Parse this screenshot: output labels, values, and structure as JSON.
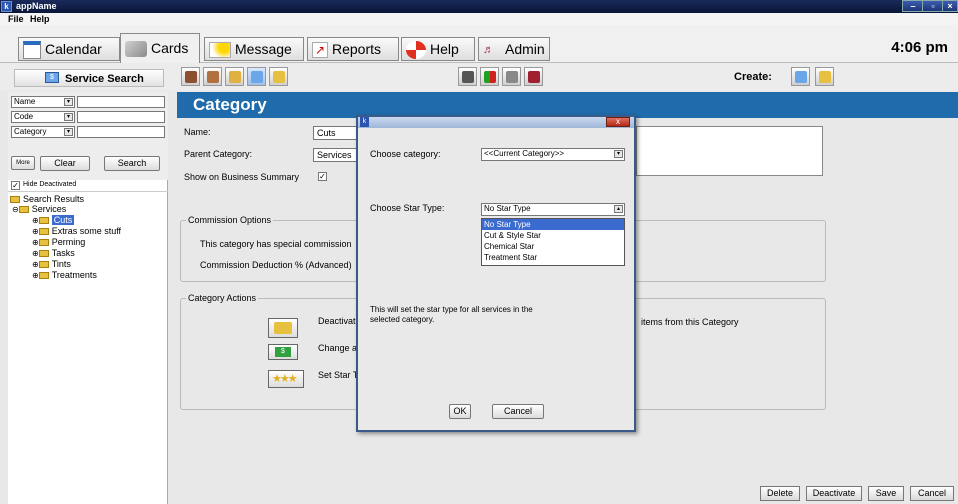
{
  "window": {
    "app_name": "appName",
    "app_icon": "k"
  },
  "menu": [
    "File",
    "Help"
  ],
  "tabs": [
    {
      "label": "Calendar",
      "icon": "calendar-icon"
    },
    {
      "label": "Cards",
      "icon": "cards-icon"
    },
    {
      "label": "Message",
      "icon": "message-icon"
    },
    {
      "label": "Reports",
      "icon": "reports-icon"
    },
    {
      "label": "Help",
      "icon": "help-icon"
    },
    {
      "label": "Admin",
      "icon": "admin-icon"
    }
  ],
  "clock": "4:06 pm",
  "toolbar": {
    "service_search": "Service Search",
    "create_label": "Create:"
  },
  "search": {
    "fields": [
      "Name",
      "Code",
      "Category"
    ],
    "more": "More",
    "clear": "Clear",
    "search": "Search",
    "hide_deactivated": "Hide Deactivated"
  },
  "tree": {
    "root": "Search Results",
    "services": "Services",
    "children": [
      "Cuts",
      "Extras some stuff",
      "Perming",
      "Tasks",
      "Tints",
      "Treatments"
    ]
  },
  "page_title": "Category",
  "form": {
    "name_label": "Name:",
    "name_value": "Cuts",
    "parent_label": "Parent Category:",
    "parent_value": "Services",
    "show_label": "Show on Business Summary"
  },
  "commission": {
    "title": "Commission Options",
    "line1": "This category has special commission",
    "line2": "Commission Deduction % (Advanced)"
  },
  "actions": {
    "title": "Category Actions",
    "deactivate": "Deactivat",
    "change": "Change a",
    "set_star": "Set Star T",
    "items_text": "items from this Category"
  },
  "bottom": {
    "delete": "Delete",
    "deactivate": "Deactivate",
    "save": "Save",
    "cancel": "Cancel"
  },
  "dialog": {
    "title_icon": "k",
    "close": "x",
    "choose_category_label": "Choose category:",
    "choose_category_value": "<<Current Category>>",
    "choose_star_label": "Choose Star Type:",
    "star_selected": "No Star Type",
    "star_options": [
      "No Star Type",
      "Cut & Style Star",
      "Chemical Star",
      "Treatment Star"
    ],
    "info": "This will set the star type for all services in the selected category.",
    "ok": "OK",
    "cancel": "Cancel"
  },
  "colors": {
    "header_blue": "#1f6bab",
    "highlight": "#3c6bd0",
    "titlebar": "#0f1e4a"
  }
}
